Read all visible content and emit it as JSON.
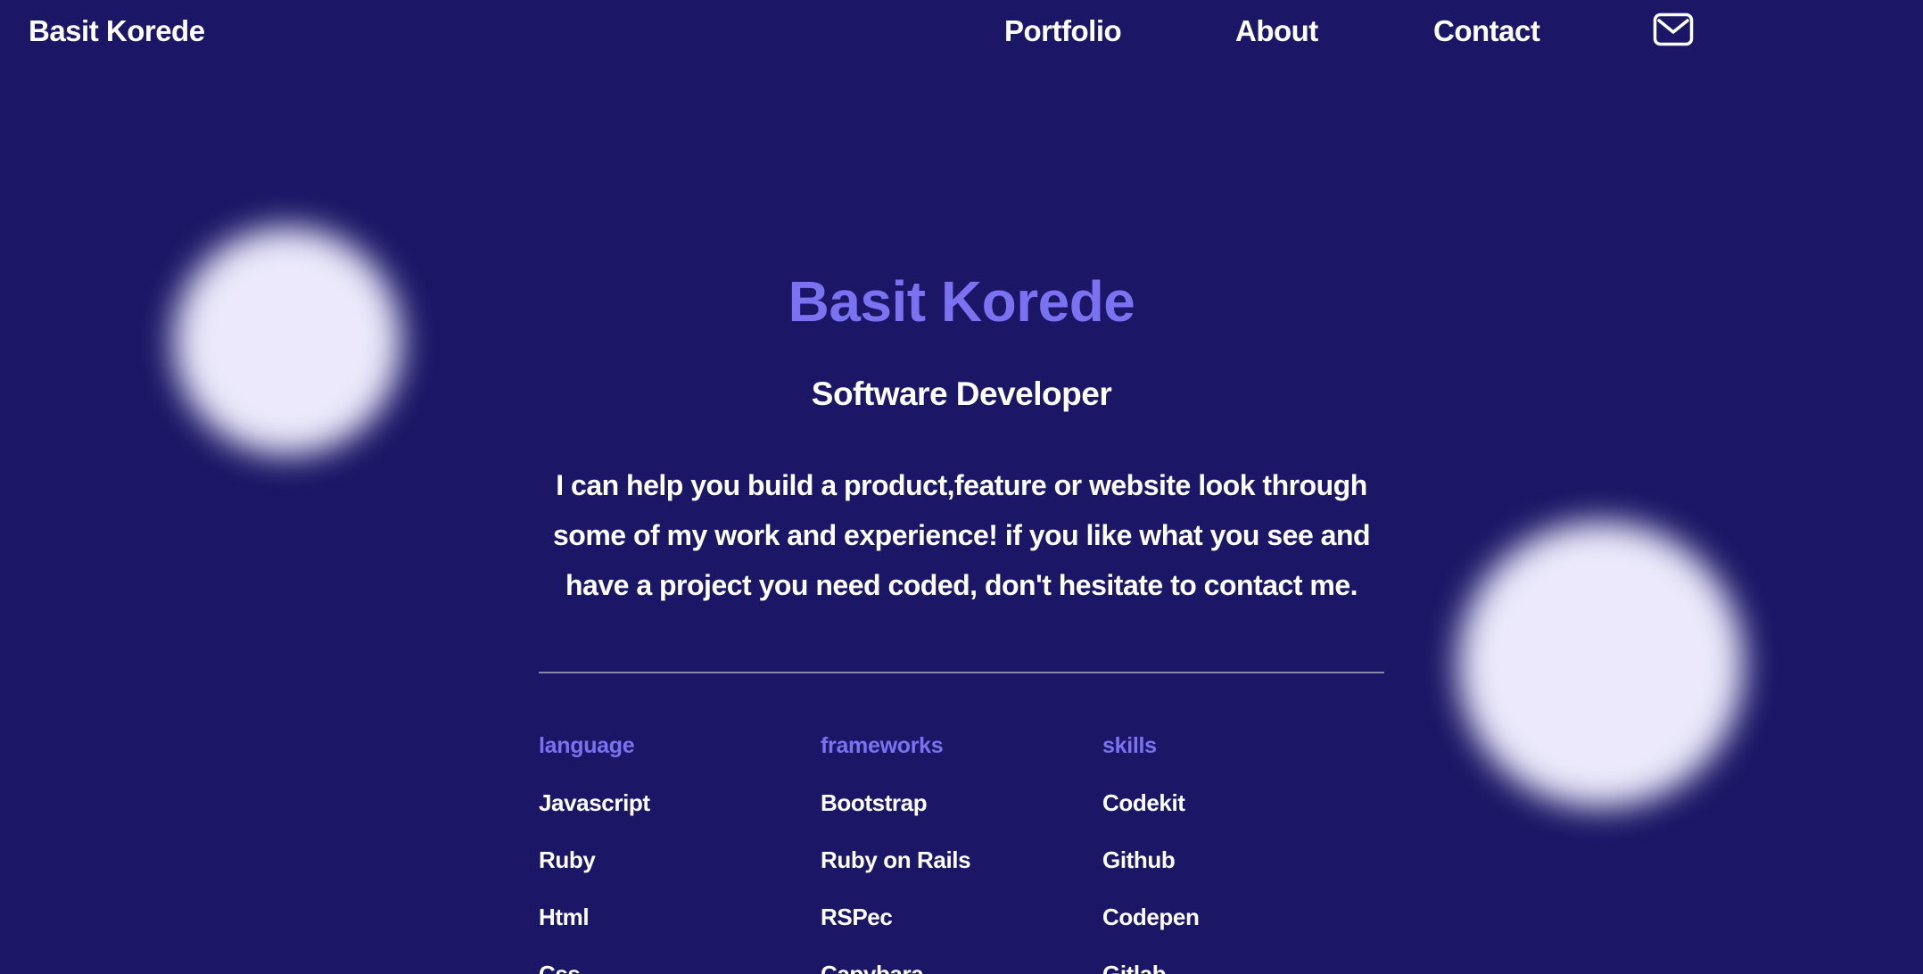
{
  "header": {
    "brand": "Basit Korede",
    "nav": {
      "portfolio": "Portfolio",
      "about": "About",
      "contact": "Contact"
    },
    "mail_icon": "envelope-icon"
  },
  "hero": {
    "name": "Basit Korede",
    "role": "Software Developer",
    "description": "I can help you build a product,feature or website look through some of my work and experience! if you like what you see and have a project you need coded, don't hesitate to contact me."
  },
  "stack": {
    "language": {
      "heading": "language",
      "items": [
        "Javascript",
        "Ruby",
        "Html",
        "Css"
      ]
    },
    "frameworks": {
      "heading": "frameworks",
      "items": [
        "Bootstrap",
        "Ruby on Rails",
        "RSPec",
        "Capybara"
      ]
    },
    "skills": {
      "heading": "skills",
      "items": [
        "Codekit",
        "Github",
        "Codepen",
        "Gitlab"
      ]
    }
  },
  "colors": {
    "background": "#1b1766",
    "accent": "#7a72f0",
    "text": "#ffffff",
    "orb": "#ebe9fb"
  }
}
